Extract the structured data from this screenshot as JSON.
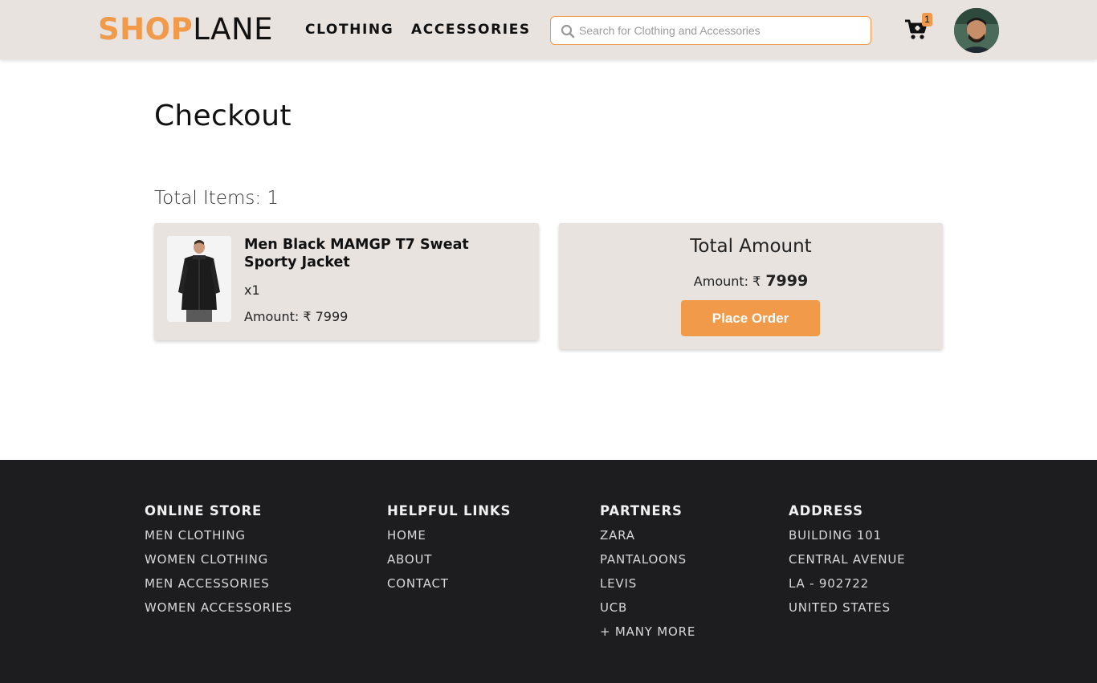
{
  "header": {
    "logo_part1": "SHOP",
    "logo_part2": "LANE",
    "nav": [
      "CLOTHING",
      "ACCESSORIES"
    ],
    "search_placeholder": "Search for Clothing and Accessories",
    "cart_count": "1",
    "icons": {
      "search": "search-icon",
      "cart": "cart-icon",
      "avatar": "user-avatar"
    },
    "accent_color": "#f09a4a"
  },
  "main": {
    "title": "Checkout",
    "total_items": "Total Items: 1",
    "item": {
      "name": "Men Black MAMGP T7 Sweat Sporty Jacket",
      "quantity": "x1",
      "amount": "Amount: ₹ 7999"
    },
    "summary": {
      "heading": "Total Amount",
      "amount_label": "Amount: ₹",
      "amount_value": "7999",
      "button": "Place Order"
    }
  },
  "footer": {
    "columns": [
      {
        "heading": "ONLINE STORE",
        "links": [
          "MEN CLOTHING",
          "WOMEN CLOTHING",
          "MEN ACCESSORIES",
          "WOMEN ACCESSORIES"
        ]
      },
      {
        "heading": "HELPFUL LINKS",
        "links": [
          "HOME",
          "ABOUT",
          "CONTACT"
        ]
      },
      {
        "heading": "PARTNERS",
        "links": [
          "ZARA",
          "PANTALOONS",
          "LEVIS",
          "UCB",
          "+ MANY MORE"
        ]
      },
      {
        "heading": "ADDRESS",
        "links": [
          "BUILDING 101",
          "CENTRAL AVENUE",
          "LA - 902722",
          "UNITED STATES"
        ]
      }
    ]
  }
}
